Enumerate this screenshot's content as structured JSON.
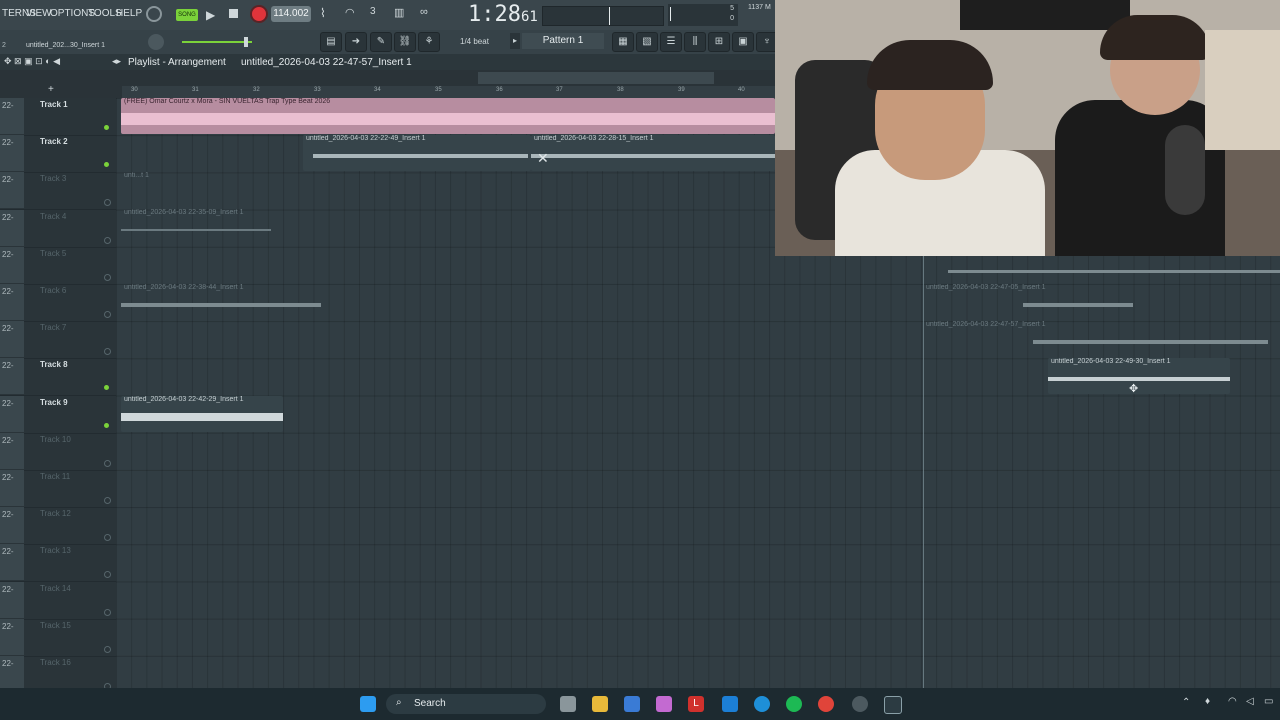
{
  "menu": {
    "items": [
      "TERNS",
      "VIEW",
      "OPTIONS",
      "TOOLS",
      "HELP"
    ]
  },
  "transport": {
    "mode": "SONG",
    "tempo": "114.002",
    "time": "1:28",
    "time_sub": "61",
    "cpu": "1137 M",
    "counter_top": "5",
    "counter_bot": "0"
  },
  "project": {
    "label": "untitled_202...30_Insert 1"
  },
  "toolbar2": {
    "snap": "1/4 beat",
    "pattern": "Pattern 1"
  },
  "playlist": {
    "title": "Playlist - Arrangement",
    "path": "untitled_2026-04-03 22-47-57_Insert 1"
  },
  "ruler": {
    "ticks": [
      "30",
      "31",
      "32",
      "33",
      "34",
      "35",
      "36",
      "37",
      "38",
      "39",
      "40"
    ]
  },
  "tracks": [
    {
      "name": "Track 1",
      "active": true
    },
    {
      "name": "Track 2",
      "active": true
    },
    {
      "name": "Track 3",
      "active": false
    },
    {
      "name": "Track 4",
      "active": false
    },
    {
      "name": "Track 5",
      "active": false
    },
    {
      "name": "Track 6",
      "active": false
    },
    {
      "name": "Track 7",
      "active": false
    },
    {
      "name": "Track 8",
      "active": true
    },
    {
      "name": "Track 9",
      "active": true
    },
    {
      "name": "Track 10",
      "active": false
    },
    {
      "name": "Track 11",
      "active": false
    },
    {
      "name": "Track 12",
      "active": false
    },
    {
      "name": "Track 13",
      "active": false
    },
    {
      "name": "Track 14",
      "active": false
    },
    {
      "name": "Track 15",
      "active": false
    },
    {
      "name": "Track 16",
      "active": false
    }
  ],
  "left_labels": [
    "22-",
    "22-",
    "22-",
    "22-",
    "22-",
    "22-",
    "22-",
    "22-",
    "22-",
    "22-",
    "22-",
    "22-",
    "22-",
    "22-",
    "22-",
    "22-",
    "22-"
  ],
  "clips": {
    "c1": "(FREE) Omar Courtz x Mora - SIN VUELTAS Trap Type Beat 2026",
    "c2a": "untitled_2026-04-03 22-22-49_Insert 1",
    "c2b": "untitled_2026-04-03 22-28-15_Insert 1",
    "c3": "unti...t 1",
    "c4": "untitled_2026-04-03 22-35-09_Insert 1",
    "c6": "untitled_2026-04-03 22-38-44_Insert 1",
    "c6b": "untitled_2026-04-03 22-47-05_Insert 1",
    "c7b": "untitled_2026-04-03 22-47-57_Insert 1",
    "c8b": "untitled_2026-04-03 22-49-30_Insert 1",
    "c9": "untitled_2026-04-03 22-42-29_Insert 1"
  },
  "taskbar": {
    "search": "Search"
  },
  "colors": {
    "accent": "#7bd23a",
    "clip_pink": "#e9b2c8",
    "record": "#e0343b"
  }
}
